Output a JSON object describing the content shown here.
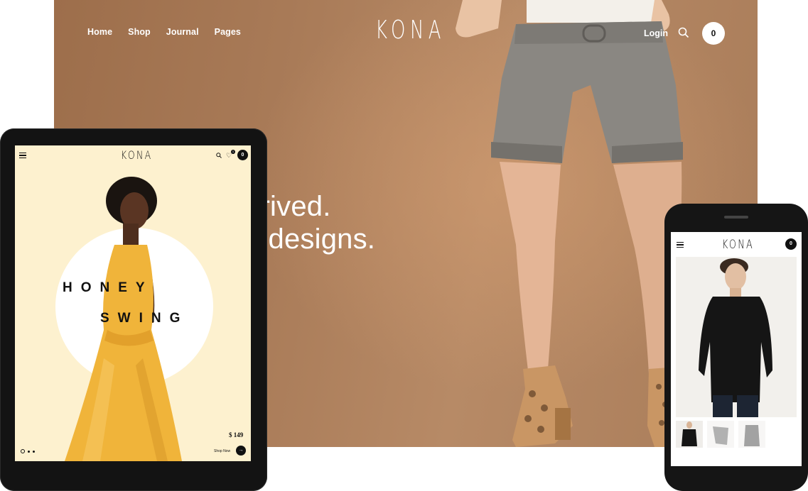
{
  "desktop": {
    "nav": [
      "Home",
      "Shop",
      "Journal",
      "Pages"
    ],
    "logo": "KONA",
    "login": "Login",
    "cart_count": "0",
    "headline_line1": "rrived.",
    "headline_line2": "y designs."
  },
  "tablet": {
    "logo": "KONA",
    "heart_count": "1",
    "cart_count": "0",
    "hero_word1": "HONEY",
    "hero_word2": "SWING",
    "price": "$ 149",
    "shop_now": "Shop Now",
    "arrow": "→"
  },
  "phone": {
    "logo": "KONA",
    "cart_count": "0"
  },
  "icons": {
    "search": "search-icon",
    "menu": "hamburger-menu-icon",
    "heart": "heart-icon",
    "arrow": "arrow-right-icon"
  },
  "colors": {
    "desktop_bg": "#a87a57",
    "tablet_bg": "#fdf1cf",
    "dress": "#f0b43a",
    "device_frame": "#131313"
  }
}
